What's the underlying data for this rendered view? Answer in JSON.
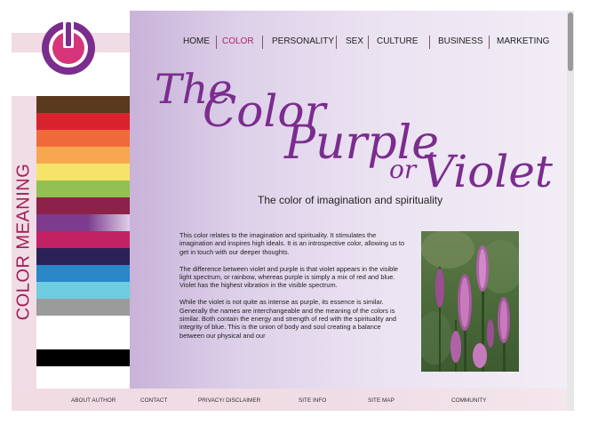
{
  "nav": {
    "items": [
      {
        "label": "HOME"
      },
      {
        "label": "COLOR",
        "active": true
      },
      {
        "label": "PERSONALITY"
      },
      {
        "label": "SEX"
      },
      {
        "label": "CULTURE"
      },
      {
        "label": "BUSINESS"
      },
      {
        "label": "MARKETING"
      }
    ]
  },
  "sidebar": {
    "label": "COLOR MEANING",
    "stripes": [
      "#5a3a1e",
      "#d8232e",
      "#ef6a3a",
      "#f7a74f",
      "#f6e36a",
      "#92c151",
      "#8c2249",
      "#7d3b8e",
      "#c22163",
      "#2a2157",
      "#2a86c6",
      "#6ecde0",
      "#9b9b9b",
      "#ffffff",
      "#ffffff",
      "#000000"
    ]
  },
  "title": {
    "line1": "The",
    "line2": "Color",
    "line3": "Purple",
    "line4": "or",
    "line5": "Violet",
    "color": "#7b2d8e"
  },
  "subtitle": "The color of imagination and spirituality",
  "body": {
    "paragraphs": [
      "This color relates to the imagination and spirituality. It stimulates the imagination and inspires high ideals. It is an introspective color, allowing us to get in touch with our deeper thoughts.",
      "The difference between violet and purple is that violet appears in the visible light spectrum, or rainbow, whereas purple is simply a mix of red and blue. Violet has the highest vibration in the visible spectrum.",
      "While the violet is not quite as intense as purple, its essence is similar. Generally the names are interchangeable and the meaning of the colors is similar. Both contain the energy and strength of red with the spirituality and integrity of blue. This is the union of body and soul creating a balance between our physical and our"
    ]
  },
  "photo": {
    "icon": "flower-photo"
  },
  "footer": {
    "items": [
      {
        "label": "ABOUT AUTHOR"
      },
      {
        "label": "CONTACT"
      },
      {
        "label": "PRIVACY/ DISCLAIMER"
      },
      {
        "label": "SITE INFO"
      },
      {
        "label": "SITE MAP"
      },
      {
        "label": "COMMUNITY"
      }
    ]
  },
  "colors": {
    "accent": "#b0246a",
    "band": "#f1dce3",
    "panel": "#ddd0e9"
  }
}
